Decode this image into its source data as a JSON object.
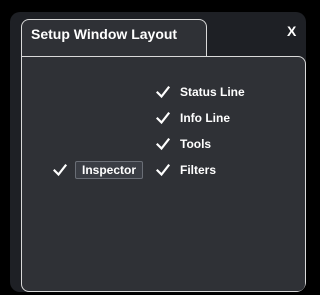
{
  "window": {
    "title": "Setup Window Layout",
    "close_label": "X"
  },
  "options": {
    "status_line": {
      "label": "Status Line",
      "checked": true
    },
    "info_line": {
      "label": "Info Line",
      "checked": true
    },
    "tools": {
      "label": "Tools",
      "checked": true
    },
    "filters": {
      "label": "Filters",
      "checked": true
    },
    "inspector": {
      "label": "Inspector",
      "checked": true
    }
  },
  "colors": {
    "panel_bg": "#2f3136",
    "outer_bg": "#1e2025",
    "border": "#d9d9d9",
    "text": "#ffffff"
  }
}
